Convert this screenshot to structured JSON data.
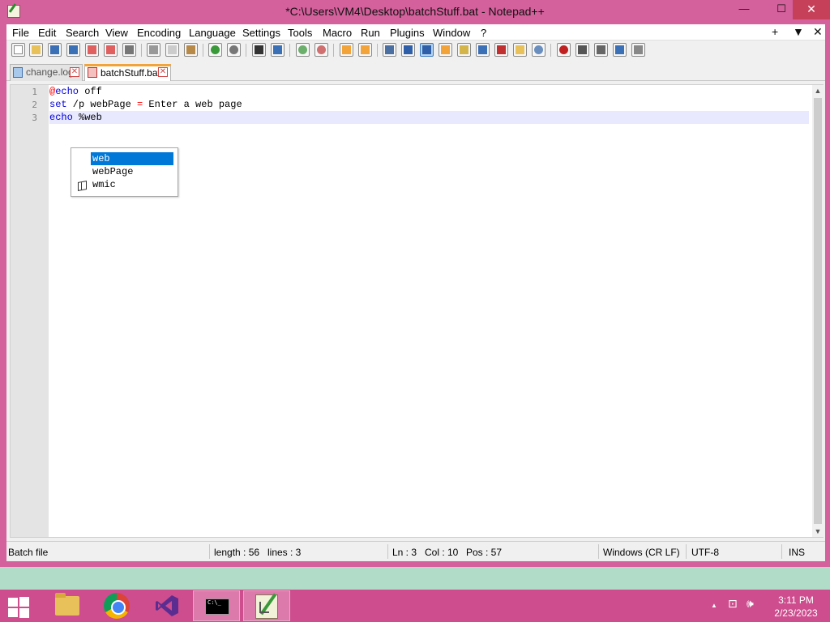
{
  "window": {
    "title": "*C:\\Users\\VM4\\Desktop\\batchStuff.bat - Notepad++",
    "min_glyph": "—",
    "max_glyph": "☐",
    "close_glyph": "✕"
  },
  "menubar": {
    "items": [
      "File",
      "Edit",
      "Search",
      "View",
      "Encoding",
      "Language",
      "Settings",
      "Tools",
      "Macro",
      "Run",
      "Plugins",
      "Window",
      "?"
    ],
    "right": [
      "+",
      "▼",
      "✕"
    ]
  },
  "toolbar": {
    "icons": [
      "new-file-icon",
      "open-file-icon",
      "save-icon",
      "save-all-icon",
      "close-icon",
      "close-all-icon",
      "print-icon",
      "cut-icon",
      "copy-icon",
      "paste-icon",
      "undo-icon",
      "redo-icon",
      "find-icon",
      "replace-icon",
      "zoom-in-icon",
      "zoom-out-icon",
      "sync-vertical-icon",
      "sync-horizontal-icon",
      "word-wrap-icon",
      "show-all-characters-icon",
      "indent-guide-icon",
      "user-language-icon",
      "document-map-icon",
      "function-list-icon",
      "folder-workspace-icon",
      "monitoring-icon",
      "record-macro-icon",
      "stop-macro-icon",
      "play-macro-icon",
      "run-macro-multiple-icon",
      "save-macro-icon"
    ]
  },
  "tabs": [
    {
      "label": "change.log",
      "active": false
    },
    {
      "label": "batchStuff.bat",
      "active": true
    }
  ],
  "editor": {
    "lines": [
      {
        "number": "1",
        "tokens": [
          {
            "t": "@",
            "c": "op"
          },
          {
            "t": "echo",
            "c": "kw"
          },
          {
            "t": " off",
            "c": "tx"
          }
        ]
      },
      {
        "number": "2",
        "tokens": [
          {
            "t": "set",
            "c": "kw"
          },
          {
            "t": " /p webPage ",
            "c": "tx"
          },
          {
            "t": "=",
            "c": "op"
          },
          {
            "t": " Enter a web page",
            "c": "tx"
          }
        ]
      },
      {
        "number": "3",
        "tokens": [
          {
            "t": "echo",
            "c": "kw"
          },
          {
            "t": " %web",
            "c": "tx"
          }
        ]
      }
    ],
    "current_line": 3
  },
  "autocomplete": {
    "items": [
      "web",
      "webPage",
      "wmic"
    ],
    "selected_index": 0
  },
  "scrollbar": {
    "up": "▲",
    "down": "▼"
  },
  "statusbar": {
    "file_type": "Batch file",
    "length": "length : 56",
    "lines": "lines : 3",
    "ln": "Ln : 3",
    "col": "Col : 10",
    "pos": "Pos : 57",
    "eol": "Windows (CR LF)",
    "encoding": "UTF-8",
    "mode": "INS"
  },
  "taskbar": {
    "cmd_text": "C:\\_",
    "tray_glyphs": [
      "▲",
      "⊡",
      "🕪"
    ],
    "time": "3:11 PM",
    "date": "2/23/2023"
  },
  "colors": {
    "window_frame": "#d4609c",
    "taskbar": "#cd4d8e",
    "desktop": "#b1dcc8",
    "keyword": "#0000d8",
    "operator": "#ff0000",
    "selection": "#0078d7",
    "tab_accent": "#f2a33a"
  }
}
